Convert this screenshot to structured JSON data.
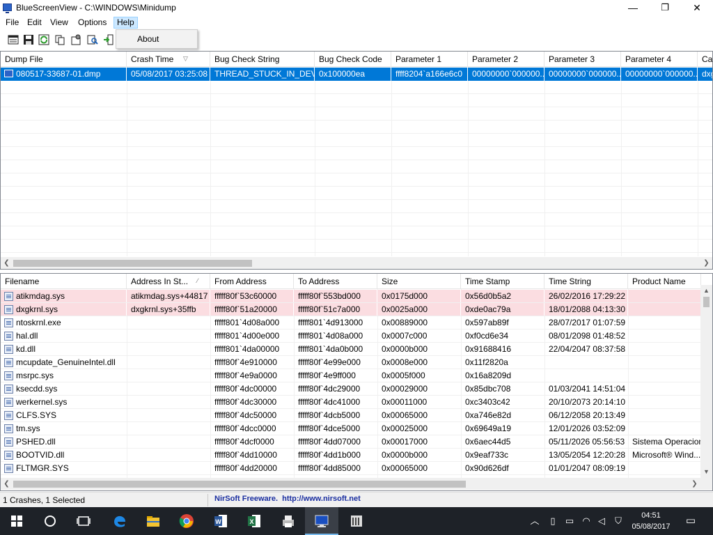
{
  "window": {
    "title": "BlueScreenView   -   C:\\WINDOWS\\Minidump",
    "minimize": "—",
    "maximize": "❐",
    "close": "✕"
  },
  "menu": {
    "file": "File",
    "edit": "Edit",
    "view": "View",
    "options": "Options",
    "help": "Help",
    "help_items": [
      "About"
    ]
  },
  "toolbar": {
    "icons": [
      "properties-icon",
      "save-icon",
      "refresh-icon",
      "copy-icon",
      "advanced-options-icon",
      "find-icon",
      "exit-icon"
    ]
  },
  "upper_list": {
    "columns": [
      "Dump File",
      "Crash Time",
      "Bug Check String",
      "Bug Check Code",
      "Parameter 1",
      "Parameter 2",
      "Parameter 3",
      "Parameter 4",
      "Ca"
    ],
    "sorted_column": "Crash Time",
    "rows": [
      {
        "dump_file": "080517-33687-01.dmp",
        "crash_time": "05/08/2017 03:25:08",
        "bug_check_string": "THREAD_STUCK_IN_DEV...",
        "bug_check_code": "0x100000ea",
        "param1": "ffff8204`a166e6c0",
        "param2": "00000000`000000...",
        "param3": "00000000`000000...",
        "param4": "00000000`000000...",
        "caused_by": "dxg",
        "selected": true
      }
    ]
  },
  "lower_list": {
    "columns": [
      "Filename",
      "Address In St...",
      "From Address",
      "To Address",
      "Size",
      "Time Stamp",
      "Time String",
      "Product Name"
    ],
    "rows": [
      {
        "filename": "atikmdag.sys",
        "addr_in_stack": "atikmdag.sys+44817",
        "from": "fffff80f`53c60000",
        "to": "fffff80f`553bd000",
        "size": "0x0175d000",
        "timestamp": "0x56d0b5a2",
        "timestring": "26/02/2016 17:29:22",
        "product": "",
        "highlight": true
      },
      {
        "filename": "dxgkrnl.sys",
        "addr_in_stack": "dxgkrnl.sys+35ffb",
        "from": "fffff80f`51a20000",
        "to": "fffff80f`51c7a000",
        "size": "0x0025a000",
        "timestamp": "0xde0ac79a",
        "timestring": "18/01/2088 04:13:30",
        "product": "",
        "highlight": true
      },
      {
        "filename": "ntoskrnl.exe",
        "addr_in_stack": "",
        "from": "fffff801`4d08a000",
        "to": "fffff801`4d913000",
        "size": "0x00889000",
        "timestamp": "0x597ab89f",
        "timestring": "28/07/2017 01:07:59",
        "product": ""
      },
      {
        "filename": "hal.dll",
        "addr_in_stack": "",
        "from": "fffff801`4d00e000",
        "to": "fffff801`4d08a000",
        "size": "0x0007c000",
        "timestamp": "0xf0cd6e34",
        "timestring": "08/01/2098 01:48:52",
        "product": ""
      },
      {
        "filename": "kd.dll",
        "addr_in_stack": "",
        "from": "fffff801`4da00000",
        "to": "fffff801`4da0b000",
        "size": "0x0000b000",
        "timestamp": "0x91688416",
        "timestring": "22/04/2047 08:37:58",
        "product": ""
      },
      {
        "filename": "mcupdate_GenuineIntel.dll",
        "addr_in_stack": "",
        "from": "fffff80f`4e910000",
        "to": "fffff80f`4e99e000",
        "size": "0x0008e000",
        "timestamp": "0x11f2820a",
        "timestring": "",
        "product": ""
      },
      {
        "filename": "msrpc.sys",
        "addr_in_stack": "",
        "from": "fffff80f`4e9a0000",
        "to": "fffff80f`4e9ff000",
        "size": "0x0005f000",
        "timestamp": "0x16a8209d",
        "timestring": "",
        "product": ""
      },
      {
        "filename": "ksecdd.sys",
        "addr_in_stack": "",
        "from": "fffff80f`4dc00000",
        "to": "fffff80f`4dc29000",
        "size": "0x00029000",
        "timestamp": "0x85dbc708",
        "timestring": "01/03/2041 14:51:04",
        "product": ""
      },
      {
        "filename": "werkernel.sys",
        "addr_in_stack": "",
        "from": "fffff80f`4dc30000",
        "to": "fffff80f`4dc41000",
        "size": "0x00011000",
        "timestamp": "0xc3403c42",
        "timestring": "20/10/2073 20:14:10",
        "product": ""
      },
      {
        "filename": "CLFS.SYS",
        "addr_in_stack": "",
        "from": "fffff80f`4dc50000",
        "to": "fffff80f`4dcb5000",
        "size": "0x00065000",
        "timestamp": "0xa746e82d",
        "timestring": "06/12/2058 20:13:49",
        "product": ""
      },
      {
        "filename": "tm.sys",
        "addr_in_stack": "",
        "from": "fffff80f`4dcc0000",
        "to": "fffff80f`4dce5000",
        "size": "0x00025000",
        "timestamp": "0x69649a19",
        "timestring": "12/01/2026 03:52:09",
        "product": ""
      },
      {
        "filename": "PSHED.dll",
        "addr_in_stack": "",
        "from": "fffff80f`4dcf0000",
        "to": "fffff80f`4dd07000",
        "size": "0x00017000",
        "timestamp": "0x6aec44d5",
        "timestring": "05/11/2026 05:56:53",
        "product": "Sistema Operacion"
      },
      {
        "filename": "BOOTVID.dll",
        "addr_in_stack": "",
        "from": "fffff80f`4dd10000",
        "to": "fffff80f`4dd1b000",
        "size": "0x0000b000",
        "timestamp": "0x9eaf733c",
        "timestring": "13/05/2054 12:20:28",
        "product": "Microsoft® Wind..."
      },
      {
        "filename": "FLTMGR.SYS",
        "addr_in_stack": "",
        "from": "fffff80f`4dd20000",
        "to": "fffff80f`4dd85000",
        "size": "0x00065000",
        "timestamp": "0x90d626df",
        "timestring": "01/01/2047 08:09:19",
        "product": ""
      }
    ]
  },
  "status": {
    "left": "1 Crashes, 1 Selected",
    "brand": "NirSoft Freeware.",
    "url": "http://www.nirsoft.net"
  },
  "taskbar": {
    "apps": [
      "start-icon",
      "cortana-icon",
      "task-view-icon",
      "edge-icon",
      "file-explorer-icon",
      "chrome-icon",
      "word-icon",
      "excel-icon",
      "printer-app-icon",
      "bluescreenview-icon",
      "calculator-icon"
    ],
    "active_app": "bluescreenview-icon",
    "time": "04:51",
    "date": "05/08/2017"
  },
  "colors": {
    "selection": "#0078d7",
    "highlight_row": "#fbdde1",
    "taskbar": "#1e2228",
    "link": "#1a2ea0"
  }
}
